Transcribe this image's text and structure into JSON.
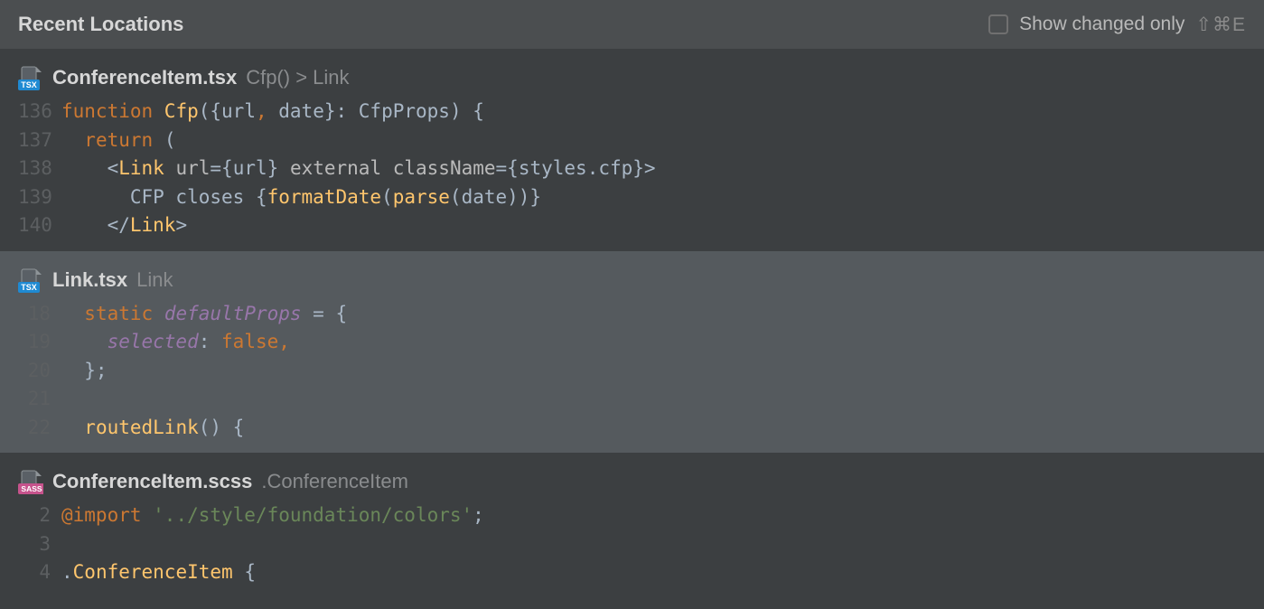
{
  "header": {
    "title": "Recent Locations",
    "show_changed_label": "Show changed only",
    "shortcut": "⇧⌘E"
  },
  "entries": [
    {
      "icon": "tsx",
      "file": "ConferenceItem.tsx",
      "breadcrumb": "Cfp() > Link",
      "selected": false,
      "lines": [
        {
          "n": "136",
          "tokens": [
            {
              "c": "kw",
              "t": "function "
            },
            {
              "c": "fn",
              "t": "Cfp"
            },
            {
              "c": "punct",
              "t": "({"
            },
            {
              "c": "plain",
              "t": "url"
            },
            {
              "c": "kw",
              "t": ", "
            },
            {
              "c": "plain",
              "t": "date"
            },
            {
              "c": "punct",
              "t": "}: "
            },
            {
              "c": "plain",
              "t": "CfpProps"
            },
            {
              "c": "punct",
              "t": ") {"
            }
          ]
        },
        {
          "n": "137",
          "tokens": [
            {
              "c": "plain",
              "t": "  "
            },
            {
              "c": "kw",
              "t": "return "
            },
            {
              "c": "punct",
              "t": "("
            }
          ]
        },
        {
          "n": "138",
          "tokens": [
            {
              "c": "plain",
              "t": "    "
            },
            {
              "c": "punct",
              "t": "<"
            },
            {
              "c": "tag",
              "t": "Link "
            },
            {
              "c": "attr",
              "t": "url"
            },
            {
              "c": "punct",
              "t": "="
            },
            {
              "c": "punct",
              "t": "{"
            },
            {
              "c": "plain",
              "t": "url"
            },
            {
              "c": "punct",
              "t": "} "
            },
            {
              "c": "attr",
              "t": "external "
            },
            {
              "c": "attr",
              "t": "className"
            },
            {
              "c": "punct",
              "t": "={"
            },
            {
              "c": "plain",
              "t": "styles"
            },
            {
              "c": "punct",
              "t": "."
            },
            {
              "c": "plain",
              "t": "cfp"
            },
            {
              "c": "punct",
              "t": "}>"
            }
          ]
        },
        {
          "n": "139",
          "tokens": [
            {
              "c": "plain",
              "t": "      CFP closes "
            },
            {
              "c": "punct",
              "t": "{"
            },
            {
              "c": "call",
              "t": "formatDate"
            },
            {
              "c": "punct",
              "t": "("
            },
            {
              "c": "call",
              "t": "parse"
            },
            {
              "c": "punct",
              "t": "("
            },
            {
              "c": "plain",
              "t": "date"
            },
            {
              "c": "punct",
              "t": "))}"
            }
          ]
        },
        {
          "n": "140",
          "tokens": [
            {
              "c": "plain",
              "t": "    "
            },
            {
              "c": "punct",
              "t": "</"
            },
            {
              "c": "tag",
              "t": "Link"
            },
            {
              "c": "punct",
              "t": ">"
            }
          ]
        }
      ]
    },
    {
      "icon": "tsx",
      "file": "Link.tsx",
      "breadcrumb": "Link",
      "selected": true,
      "lines": [
        {
          "n": "18",
          "tokens": [
            {
              "c": "plain",
              "t": "  "
            },
            {
              "c": "kw",
              "t": "static "
            },
            {
              "c": "prop",
              "t": "defaultProps"
            },
            {
              "c": "plain",
              "t": " = {"
            }
          ]
        },
        {
          "n": "19",
          "tokens": [
            {
              "c": "plain",
              "t": "    "
            },
            {
              "c": "prop",
              "t": "selected"
            },
            {
              "c": "plain",
              "t": ": "
            },
            {
              "c": "kw",
              "t": "false,"
            }
          ]
        },
        {
          "n": "20",
          "tokens": [
            {
              "c": "plain",
              "t": "  };"
            }
          ]
        },
        {
          "n": "21",
          "tokens": [
            {
              "c": "plain",
              "t": ""
            }
          ]
        },
        {
          "n": "22",
          "tokens": [
            {
              "c": "plain",
              "t": "  "
            },
            {
              "c": "fn",
              "t": "routedLink"
            },
            {
              "c": "plain",
              "t": "() {"
            }
          ]
        }
      ]
    },
    {
      "icon": "sass",
      "file": "ConferenceItem.scss",
      "breadcrumb": ".ConferenceItem",
      "selected": false,
      "lines": [
        {
          "n": "2",
          "tokens": [
            {
              "c": "kw",
              "t": "@import "
            },
            {
              "c": "str",
              "t": "'../style/foundation/colors'"
            },
            {
              "c": "punct",
              "t": ";"
            }
          ]
        },
        {
          "n": "3",
          "tokens": [
            {
              "c": "plain",
              "t": ""
            }
          ]
        },
        {
          "n": "4",
          "tokens": [
            {
              "c": "plain",
              "t": "."
            },
            {
              "c": "sel",
              "t": "ConferenceItem"
            },
            {
              "c": "plain",
              "t": " {"
            }
          ]
        }
      ]
    }
  ]
}
